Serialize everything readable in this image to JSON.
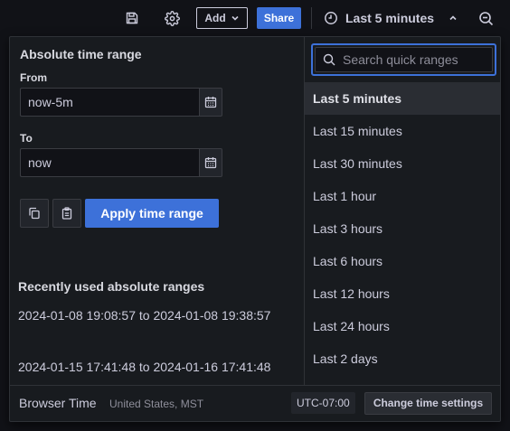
{
  "toolbar": {
    "save_icon": "save-icon",
    "settings_icon": "gear-icon",
    "add_label": "Add",
    "share_label": "Share",
    "time_range_label": "Last 5 minutes",
    "zoom_icon": "zoom-out-icon"
  },
  "picker": {
    "absolute_title": "Absolute time range",
    "from_label": "From",
    "from_value": "now-5m",
    "to_label": "To",
    "to_value": "now",
    "apply_label": "Apply time range",
    "recent_title": "Recently used absolute ranges",
    "recent_ranges": [
      "2024-01-08 19:08:57 to 2024-01-08 19:38:57",
      "2024-01-15 17:41:48 to 2024-01-16 17:41:48"
    ],
    "search_placeholder": "Search quick ranges",
    "quick_ranges": [
      "Last 5 minutes",
      "Last 15 minutes",
      "Last 30 minutes",
      "Last 1 hour",
      "Last 3 hours",
      "Last 6 hours",
      "Last 12 hours",
      "Last 24 hours",
      "Last 2 days"
    ],
    "selected_quick_range": "Last 5 minutes"
  },
  "footer": {
    "timezone_name": "Browser Time",
    "timezone_region": "United States, MST",
    "utc_offset": "UTC-07:00",
    "change_settings_label": "Change time settings"
  },
  "colors": {
    "accent": "#3d71d9",
    "background": "#111217",
    "panel": "#181b1f"
  }
}
